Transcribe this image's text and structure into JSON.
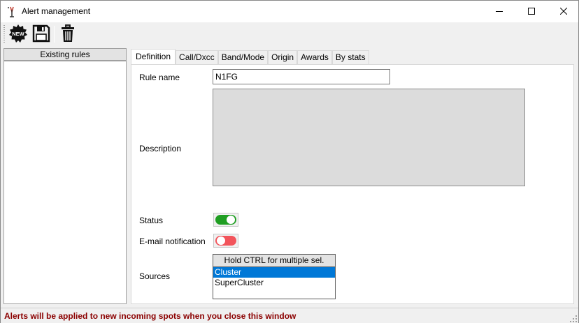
{
  "window": {
    "title": "Alert management",
    "icon": "antenna-app-icon",
    "controls": [
      "minimize-icon",
      "maximize-icon",
      "close-icon"
    ]
  },
  "toolbar": {
    "new_icon": "new-starburst-icon",
    "new_label": "NEW",
    "save_icon": "floppy-disk-icon",
    "delete_icon": "trash-can-icon"
  },
  "rules_panel": {
    "header": "Existing rules",
    "items": []
  },
  "tabs": [
    {
      "label": "Definition",
      "active": true
    },
    {
      "label": "Call/Dxcc",
      "active": false
    },
    {
      "label": "Band/Mode",
      "active": false
    },
    {
      "label": "Origin",
      "active": false
    },
    {
      "label": "Awards",
      "active": false
    },
    {
      "label": "By stats",
      "active": false
    }
  ],
  "definition": {
    "rule_name_label": "Rule name",
    "rule_name_value": "N1FG",
    "description_label": "Description",
    "description_value": "",
    "status_label": "Status",
    "status_on": true,
    "email_label": "E-mail notification",
    "email_on": false,
    "sources_label": "Sources",
    "sources_header": "Hold CTRL for multiple sel.",
    "sources": [
      {
        "label": "Cluster",
        "selected": true
      },
      {
        "label": "SuperCluster",
        "selected": false
      }
    ]
  },
  "status_bar": {
    "message": "Alerts will be applied to new incoming spots when you close this window"
  },
  "colors": {
    "toggle_on": "#1f9e22",
    "toggle_off": "#f2545b",
    "selection": "#0078d7",
    "status_text": "#8b0000"
  }
}
